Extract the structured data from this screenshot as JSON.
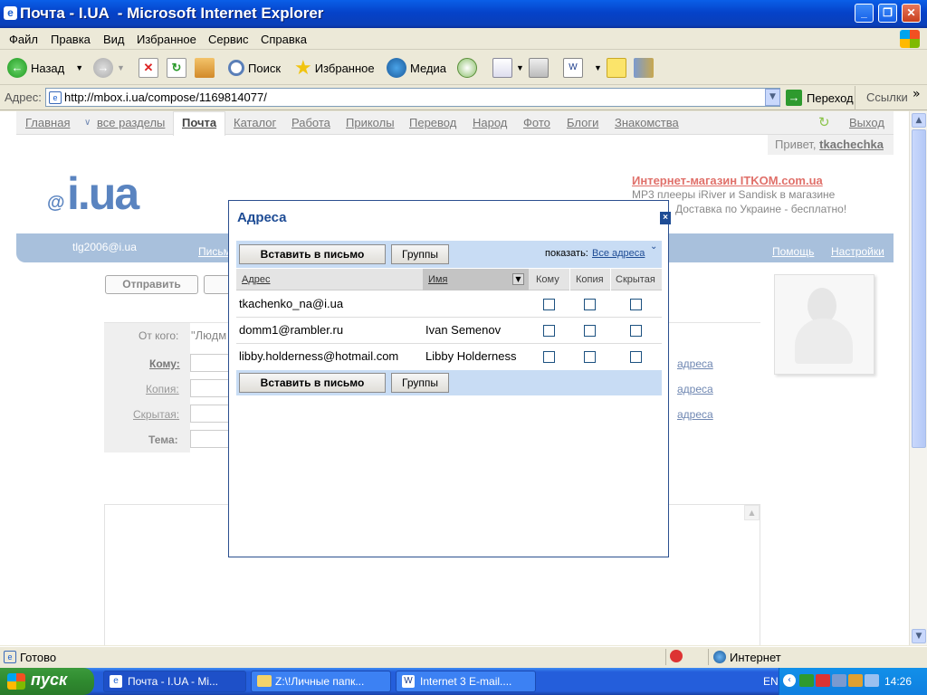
{
  "window": {
    "title": "Почта - I.UA  - Microsoft Internet Explorer"
  },
  "menu": [
    "Файл",
    "Правка",
    "Вид",
    "Избранное",
    "Сервис",
    "Справка"
  ],
  "toolbar": {
    "back": "Назад",
    "search": "Поиск",
    "favorites": "Избранное",
    "media": "Медиа"
  },
  "address": {
    "label": "Адрес:",
    "url": "http://mbox.i.ua/compose/1169814077/",
    "go": "Переход",
    "links": "Ссылки"
  },
  "site": {
    "nav": [
      "Главная",
      "все разделы",
      "Почта",
      "Каталог",
      "Работа",
      "Приколы",
      "Перевод",
      "Народ",
      "Фото",
      "Блоги",
      "Знакомства"
    ],
    "logout": "Выход",
    "greeting": "Привет,",
    "username": "tkachechka",
    "logo": "i.ua",
    "ad_title": "Интернет-магазин ITKOM.com.ua",
    "ad_line1": "MP3 плееры iRiver и Sandisk в магазине",
    "ad_line2": "Доставка по Украине - бесплатно!",
    "account": "tlg2006@i.ua",
    "letters_tab": "Письм",
    "help": "Помощь",
    "settings": "Настройки",
    "send": "Отправить",
    "from_label": "От кого:",
    "from_value": "\"Людм",
    "to_label": "Кому:",
    "cc_label": "Копия:",
    "bcc_label": "Скрытая:",
    "subject_label": "Тема:",
    "addr_link": "адреса"
  },
  "modal": {
    "title": "Адреса",
    "insert_btn": "Вставить в письмо",
    "groups_btn": "Группы",
    "show_label": "показать:",
    "show_all": "Все адреса",
    "columns": [
      "Адрес",
      "Имя",
      "Кому",
      "Копия",
      "Скрытая"
    ],
    "rows": [
      {
        "addr": "tkachenko_na@i.ua",
        "name": ""
      },
      {
        "addr": "domm1@rambler.ru",
        "name": "Ivan Semenov"
      },
      {
        "addr": "libby.holderness@hotmail.com",
        "name": "Libby Holderness"
      }
    ]
  },
  "status": {
    "text": "Готово",
    "zone": "Интернет"
  },
  "taskbar": {
    "start": "пуск",
    "tasks": [
      "Почта - I.UA  - Mi...",
      "Z:\\!Личные папк...",
      "Internet 3 E-mail...."
    ],
    "lang": "EN",
    "clock": "14:26"
  }
}
